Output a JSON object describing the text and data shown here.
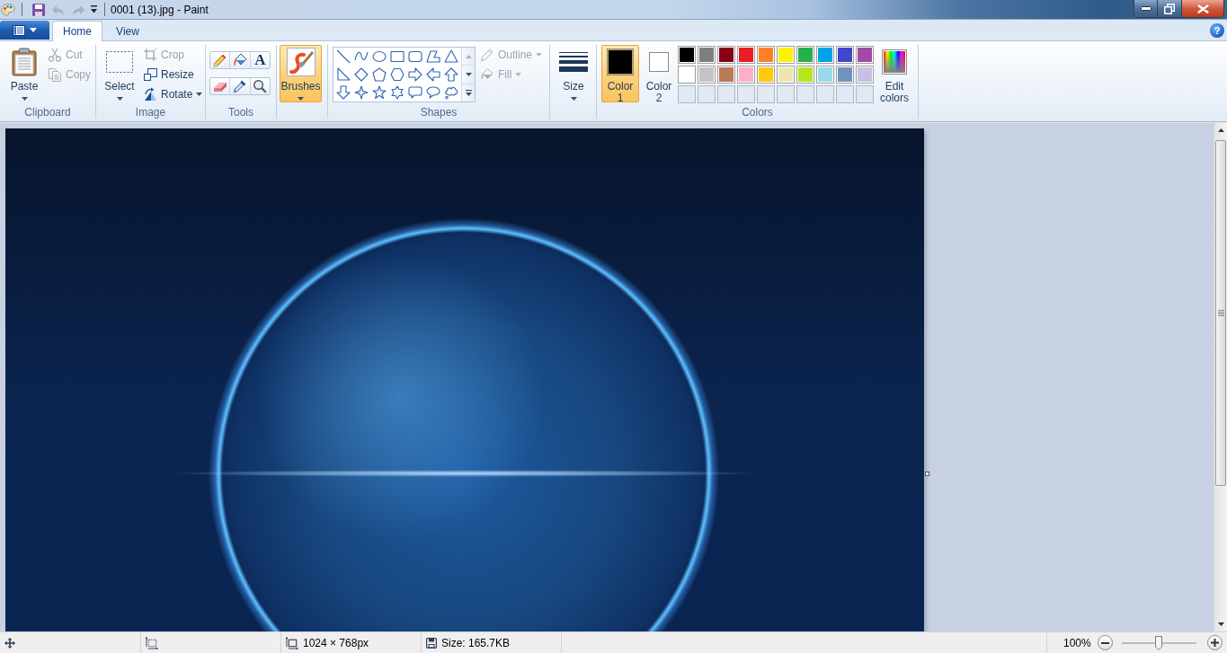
{
  "window": {
    "title": "0001 (13).jpg - Paint"
  },
  "quick_access": [
    {
      "kind": "save",
      "disabled": false
    },
    {
      "kind": "undo",
      "disabled": true
    },
    {
      "kind": "redo",
      "disabled": true
    }
  ],
  "menu_tabs": [
    {
      "label": "Home",
      "selected": true
    },
    {
      "label": "View",
      "selected": false
    }
  ],
  "help": {
    "glyph": "?"
  },
  "clipboard": {
    "label": "Clipboard",
    "paste": {
      "label": "Paste"
    },
    "actions": [
      {
        "kind": "cut",
        "label": "Cut",
        "disabled": true
      },
      {
        "kind": "copy",
        "label": "Copy",
        "disabled": true
      }
    ]
  },
  "image": {
    "label": "Image",
    "select": {
      "label": "Select"
    },
    "actions": [
      {
        "kind": "crop",
        "label": "Crop",
        "disabled": true
      },
      {
        "kind": "resize",
        "label": "Resize",
        "disabled": false
      },
      {
        "kind": "rotate",
        "label": "Rotate",
        "disabled": false
      }
    ]
  },
  "tools": {
    "label": "Tools",
    "items": [
      {
        "kind": "pencil",
        "selected": false
      },
      {
        "kind": "fill",
        "selected": false
      },
      {
        "kind": "text",
        "glyph": "A",
        "selected": false
      },
      {
        "kind": "eraser",
        "selected": false
      },
      {
        "kind": "color_picker",
        "selected": false
      },
      {
        "kind": "magnifier",
        "selected": false
      }
    ]
  },
  "brushes": {
    "label": "Brushes",
    "selected": true
  },
  "shapes": {
    "label": "Shapes",
    "options": [
      {
        "kind": "outline",
        "label": "Outline",
        "disabled": true
      },
      {
        "kind": "fill",
        "label": "Fill",
        "disabled": true
      }
    ]
  },
  "size": {
    "label": "Size"
  },
  "colors": {
    "label": "Colors",
    "active": [
      {
        "label": "Color 1",
        "color": "#000000",
        "selected": true
      },
      {
        "label": "Color 2",
        "color": "#ffffff",
        "selected": false
      }
    ],
    "palette": [
      {
        "color": "#000000"
      },
      {
        "color": "#7f7f7f"
      },
      {
        "color": "#880015"
      },
      {
        "color": "#ed1c24"
      },
      {
        "color": "#ff7f27"
      },
      {
        "color": "#fff200"
      },
      {
        "color": "#22b14c"
      },
      {
        "color": "#00a2e8"
      },
      {
        "color": "#3f48cc"
      },
      {
        "color": "#a349a4"
      },
      {
        "color": "#ffffff"
      },
      {
        "color": "#c3c3c3"
      },
      {
        "color": "#b97a57"
      },
      {
        "color": "#ffaec9"
      },
      {
        "color": "#ffc90e"
      },
      {
        "color": "#efe4b0"
      },
      {
        "color": "#b5e61d"
      },
      {
        "color": "#99d9ea"
      },
      {
        "color": "#7092be"
      },
      {
        "color": "#c8bfe7"
      }
    ],
    "edit": {
      "label": "Edit colors"
    }
  },
  "status_bar": {
    "dimensions": "1024 × 768px",
    "file_size": "Size: 165.7KB",
    "zoom": "100%",
    "zoom_slider": {
      "level": 0.5
    }
  }
}
